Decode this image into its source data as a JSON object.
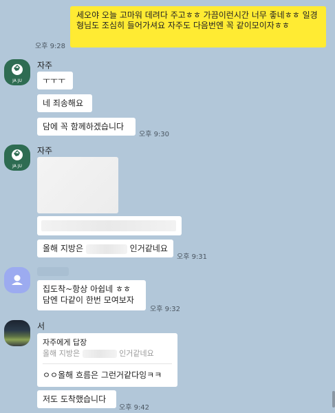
{
  "messages": {
    "m1": {
      "text": "세오야 오늘 고마워 데려다 주고ㅎㅎ 가끔이런시간 너무 좋네ㅎㅎ 일경형님도 조심히 들어가셔요 자주도 다음번엔 꼭 같이모이자ㅎㅎ",
      "time": "오후 9:28"
    },
    "g1": {
      "sender": "자주",
      "avatar_text": "JA JU",
      "b1": "ㅜㅜㅜ",
      "b2": "네 죄송해요",
      "b3": "담에 꼭 함께하겠습니다",
      "time": "오후 9:30"
    },
    "g2": {
      "sender": "자주",
      "avatar_text": "JA JU",
      "b3_pre": "올해 지방은",
      "b3_post": "인거같네요",
      "time": "오후 9:31"
    },
    "g3": {
      "b1_line1": "집도착~항상 아쉽네 ㅎㅎ",
      "b1_line2": "담엔 다같이 한번 모여보자",
      "time": "오후 9:32"
    },
    "g4": {
      "sender": "서",
      "reply_title": "자주에게 답장",
      "reply_quote_pre": "올해 지방은",
      "reply_quote_post": "인거같네요",
      "reply_text": "ㅇㅇ올해 흐름은 그런거같다잉ㅋㅋ",
      "b2": "저도 도착했습니다",
      "time": "오후 9:42"
    }
  },
  "colors": {
    "background": "#b2c7d9",
    "my_bubble": "#ffeb33",
    "other_bubble": "#ffffff",
    "avatar_jaju": "#2e6c52",
    "avatar_default": "#9cabf0"
  }
}
